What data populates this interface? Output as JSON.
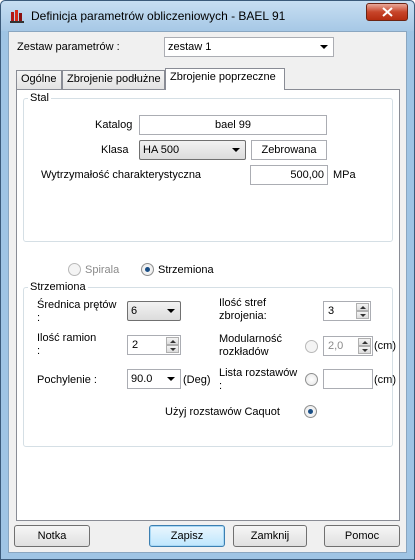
{
  "window": {
    "title": "Definicja parametrów obliczeniowych - BAEL 91"
  },
  "param_set": {
    "label": "Zestaw parametrów :",
    "value": "zestaw 1"
  },
  "tabs": [
    {
      "label": "Ogólne"
    },
    {
      "label": "Zbrojenie podłużne"
    },
    {
      "label": "Zbrojenie poprzeczne"
    }
  ],
  "steel": {
    "group_title": "Stal",
    "catalog_label": "Katalog",
    "catalog_value": "bael 99",
    "class_label": "Klasa",
    "class_value": "HA 500",
    "ribbed_button": "Zebrowana",
    "strength_label": "Wytrzymałość charakterystyczna",
    "strength_value": "500,00",
    "strength_unit": "MPa"
  },
  "type": {
    "spiral_label": "Spirala",
    "stirrups_label": "Strzemiona",
    "selected": "Strzemiona"
  },
  "stirrups": {
    "group_title": "Strzemiona",
    "diameter_label": "Średnica prętów :",
    "diameter_value": "6",
    "legs_label": "Ilość ramion :",
    "legs_value": "2",
    "inclination_label": "Pochylenie :",
    "inclination_value": "90.0",
    "inclination_unit": "(Deg)",
    "zones_label": "Ilość stref zbrojenia:",
    "zones_value": "3",
    "modularity_label": "Modularność rozkładów",
    "modularity_value": "2,0",
    "modularity_unit": "(cm)",
    "spacing_list_label": "Lista rozstawów :",
    "spacing_list_value": "",
    "spacing_list_unit": "(cm)",
    "caquot_label": "Użyj rozstawów Caquot"
  },
  "buttons": {
    "notes": "Notka",
    "save": "Zapisz",
    "close": "Zamknij",
    "help": "Pomoc"
  }
}
